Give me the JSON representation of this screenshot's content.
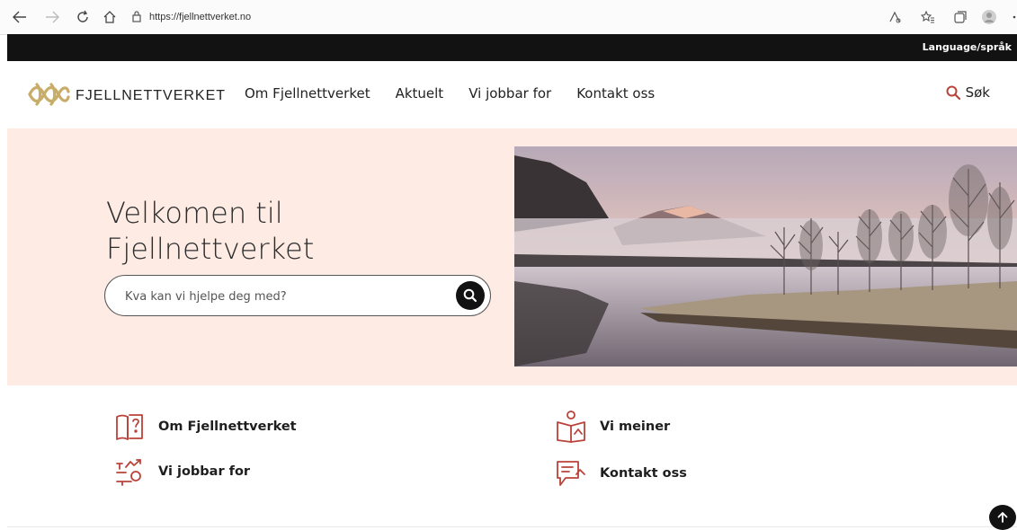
{
  "browser": {
    "url": "https://fjellnettverket.no"
  },
  "topbar": {
    "language_label": "Language/språk"
  },
  "header": {
    "logo_text": "FJELLNETTVERKET",
    "nav": [
      {
        "label": "Om Fjellnettverket"
      },
      {
        "label": "Aktuelt"
      },
      {
        "label": "Vi jobbar for"
      },
      {
        "label": "Kontakt oss"
      }
    ],
    "search_label": "Søk"
  },
  "hero": {
    "title_line1": "Velkomen til",
    "title_line2": "Fjellnettverket",
    "search_placeholder": "Kva kan vi hjelpe deg med?"
  },
  "quick_links": [
    {
      "label": "Om Fjellnettverket",
      "icon": "book-question-icon"
    },
    {
      "label": "Vi meiner",
      "icon": "person-reading-icon"
    },
    {
      "label": "Vi jobbar for",
      "icon": "growth-target-icon"
    },
    {
      "label": "Kontakt oss",
      "icon": "chat-message-icon"
    }
  ],
  "colors": {
    "accent": "#b9433a",
    "logo_gold": "#c8ad6a",
    "hero_bg": "#fdebe4",
    "topbar_bg": "#121212"
  }
}
